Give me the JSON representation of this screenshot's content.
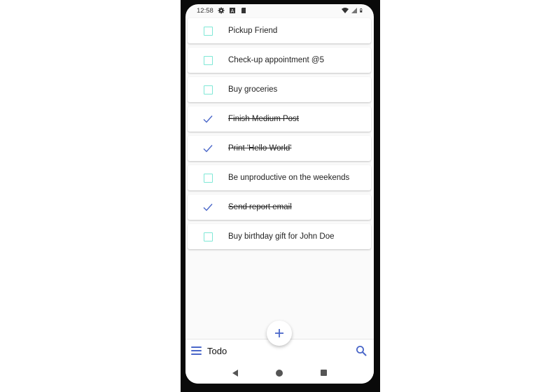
{
  "statusbar": {
    "time": "12:58",
    "left_icons": [
      "gear-icon",
      "a-box-icon",
      "sd-card-icon"
    ],
    "right_icons": [
      "wifi-icon",
      "signal-icon",
      "battery-icon"
    ]
  },
  "todos": [
    {
      "label": "Pickup Friend",
      "done": false
    },
    {
      "label": "Check-up appointment @5",
      "done": false
    },
    {
      "label": "Buy groceries",
      "done": false
    },
    {
      "label": "Finish Medium Post",
      "done": true
    },
    {
      "label": "Print 'Hello World'",
      "done": true
    },
    {
      "label": "Be unproductive on the weekends",
      "done": false
    },
    {
      "label": "Send report email",
      "done": true
    },
    {
      "label": "Buy birthday gift for John Doe",
      "done": false
    }
  ],
  "bottombar": {
    "title": "Todo",
    "menu_icon": "menu-icon",
    "search_icon": "search-icon",
    "fab_icon": "plus-icon"
  },
  "navbar": {
    "buttons": [
      "back",
      "home",
      "recents"
    ]
  },
  "colors": {
    "accent": "#4a67c9",
    "checkbox": "#7fe8d6"
  }
}
